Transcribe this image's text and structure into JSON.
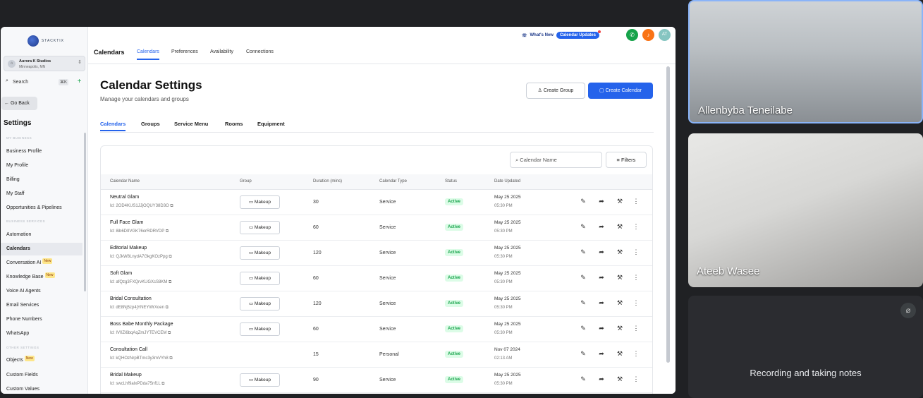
{
  "sidebar": {
    "logo_text": "STACKTIX",
    "account_name": "Aurora K Studios",
    "account_location": "Minneapolis, MN",
    "search_label": "Search",
    "search_shortcut": "⌘K",
    "go_back": "← Go Back",
    "settings_title": "Settings",
    "section_my_business": "MY BUSINESS",
    "section_business_services": "BUSINESS SERVICES",
    "section_other_settings": "OTHER SETTINGS",
    "badge_new": "New",
    "items": {
      "business_profile": "Business Profile",
      "my_profile": "My Profile",
      "billing": "Billing",
      "my_staff": "My Staff",
      "opportunities": "Opportunities & Pipelines",
      "automation": "Automation",
      "calendars": "Calendars",
      "conversation_ai": "Conversation AI",
      "knowledge_base": "Knowledge Base",
      "voice_ai": "Voice AI Agents",
      "email_services": "Email Services",
      "phone_numbers": "Phone Numbers",
      "whatsapp": "WhatsApp",
      "objects": "Objects",
      "custom_fields": "Custom Fields",
      "custom_values": "Custom Values"
    }
  },
  "topnav": {
    "section": "Calendars",
    "tabs": [
      "Calendars",
      "Preferences",
      "Availability",
      "Connections"
    ],
    "whats_new": "What's New",
    "calendar_updates": "Calendar Updates",
    "avatar_initials": "AT"
  },
  "main": {
    "title": "Calendar Settings",
    "subtitle": "Manage your calendars and groups",
    "create_group": "Create Group",
    "create_calendar": "Create Calendar",
    "subtabs": [
      "Calendars",
      "Groups",
      "Service Menu",
      "Rooms",
      "Equipment"
    ],
    "search_placeholder": "Calendar Name",
    "filters": "Filters"
  },
  "table": {
    "headers": [
      "Calendar Name",
      "Group",
      "Duration (mins)",
      "Calendar Type",
      "Status",
      "Date Updated"
    ],
    "rows": [
      {
        "name": "Neutral Glam",
        "id": "Id: 2OD4KUS1JJjOQUY38D3O",
        "group": "Makeup",
        "duration": "30",
        "type": "Service",
        "status": "Active",
        "date": "May 25 2025",
        "time": "05:30 PM"
      },
      {
        "name": "Full Face Glam",
        "id": "Id: 8ib6DIIVGK76orRDRVDP",
        "group": "Makeup",
        "duration": "60",
        "type": "Service",
        "status": "Active",
        "date": "May 25 2025",
        "time": "05:30 PM"
      },
      {
        "name": "Editorial Makeup",
        "id": "Id: QJkW8LnydA7GkgKOzPpg",
        "group": "Makeup",
        "duration": "120",
        "type": "Service",
        "status": "Active",
        "date": "May 25 2025",
        "time": "05:30 PM"
      },
      {
        "name": "Soft Glam",
        "id": "Id: afQzg3FXQrvKUGXcS8KM",
        "group": "Makeup",
        "duration": "60",
        "type": "Service",
        "status": "Active",
        "date": "May 25 2025",
        "time": "05:30 PM"
      },
      {
        "name": "Bridal Consultation",
        "id": "Id: dE8Nj5zp4jYNEYWrXoen",
        "group": "Makeup",
        "duration": "120",
        "type": "Service",
        "status": "Active",
        "date": "May 25 2025",
        "time": "05:30 PM"
      },
      {
        "name": "Boss Babe Monthly Package",
        "id": "Id: IV0Zi6bqAqZmJYTEVCEM",
        "group": "Makeup",
        "duration": "60",
        "type": "Service",
        "status": "Active",
        "date": "May 25 2025",
        "time": "05:30 PM"
      },
      {
        "name": "Consultation Call",
        "id": "Id: kQHOzNrpBTmc3y3mVYh8",
        "group": "",
        "duration": "15",
        "type": "Personal",
        "status": "Active",
        "date": "Nov 07 2024",
        "time": "02:13 AM"
      },
      {
        "name": "Bridal Makeup",
        "id": "Id: swcLhf9aIxPDda75nf1L",
        "group": "Makeup",
        "duration": "90",
        "type": "Service",
        "status": "Active",
        "date": "May 25 2025",
        "time": "05:30 PM"
      }
    ]
  },
  "video": {
    "participant1": "Allenbyba Teneilabe",
    "participant2": "Ateeb Wasee",
    "status_text": "Recording and taking notes",
    "muted_icon": "mic-off-icon"
  },
  "colors": {
    "accent": "#2563eb",
    "active_status": "#16a34a",
    "meet_bg": "#202124"
  }
}
